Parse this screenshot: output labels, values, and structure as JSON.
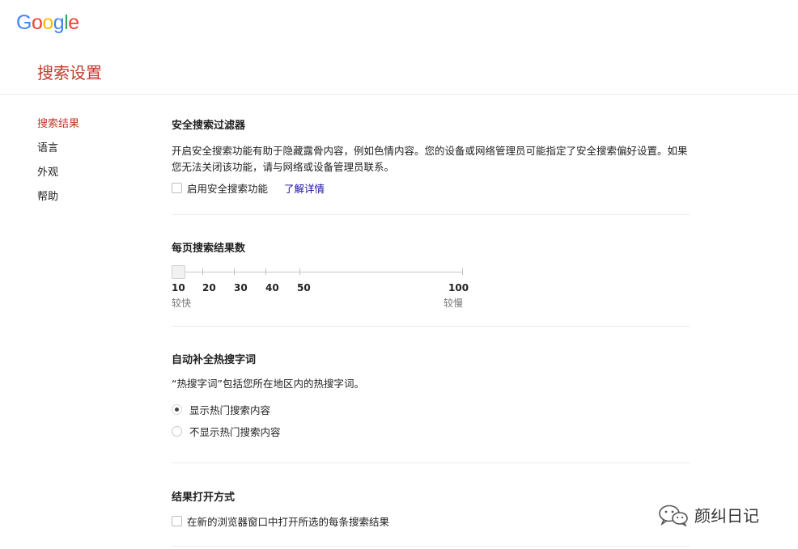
{
  "logo": {
    "text": "Google",
    "letters": [
      "G",
      "o",
      "o",
      "g",
      "l",
      "e"
    ],
    "colors": [
      "#4285F4",
      "#EA4335",
      "#FBBC05",
      "#4285F4",
      "#34A853",
      "#EA4335"
    ]
  },
  "page_title": "搜索设置",
  "sidebar": {
    "items": [
      {
        "label": "搜索结果",
        "active": true
      },
      {
        "label": "语言",
        "active": false
      },
      {
        "label": "外观",
        "active": false
      },
      {
        "label": "帮助",
        "active": false
      }
    ]
  },
  "safe_search": {
    "title": "安全搜索过滤器",
    "description": "开启安全搜索功能有助于隐藏露骨内容，例如色情内容。您的设备或网络管理员可能指定了安全搜索偏好设置。如果您无法关闭该功能，请与网络或设备管理员联系。",
    "checkbox_label": "启用安全搜索功能",
    "checkbox_checked": false,
    "link_label": "了解详情"
  },
  "results_per_page": {
    "title": "每页搜索结果数",
    "options": [
      "10",
      "20",
      "30",
      "40",
      "50",
      "100"
    ],
    "selected": "10",
    "left_caption": "较快",
    "right_caption": "较慢"
  },
  "autocomplete": {
    "title": "自动补全热搜字词",
    "description": "“热搜字词”包括您所在地区内的热搜字词。",
    "options": [
      {
        "label": "显示热门搜索内容",
        "checked": true
      },
      {
        "label": "不显示热门搜索内容",
        "checked": false
      }
    ]
  },
  "open_results": {
    "title": "结果打开方式",
    "checkbox_label": "在新的浏览器窗口中打开所选的每条搜索结果",
    "checkbox_checked": false
  },
  "watermark": {
    "text": "颜纠日记",
    "icon": "wechat-icon"
  },
  "colors": {
    "accent": "#c0392b",
    "link": "#1a0dab"
  }
}
